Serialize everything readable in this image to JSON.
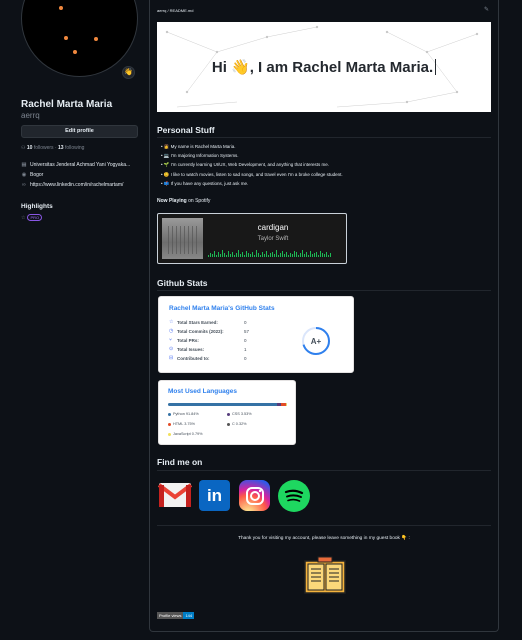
{
  "profile": {
    "full_name": "Rachel Marta Maria",
    "username": "aerrq",
    "status_emoji": "👋",
    "edit_label": "Edit profile",
    "followers_count": "10",
    "followers_label": "followers",
    "following_count": "13",
    "following_label": "following",
    "separator": "·",
    "organization": "Universitas Jenderal Achmad Yani Yogyaka...",
    "location": "Bogor",
    "link": "https://www.linkedin.com/in/rachelmartam/",
    "highlights_title": "Highlights",
    "pro_badge": "PRO"
  },
  "readme": {
    "path": "aerrq / README.md",
    "banner_text": "Hi 👋, I am Rachel Marta Maria.",
    "personal_heading": "Personal Stuff",
    "bullets": [
      "👩 My name is Rachel Marta Maria.",
      "💻 I'm majoring Information Systems.",
      "🌱 I'm currently learning UI/UX, Web Development, and anything that interests me.",
      "😊 I like to watch movies, listen to sad songs, and travel even I'm a broke college student.",
      "📫 If you have any questions, just ask me."
    ],
    "now_playing_bold": "Now Playing",
    "now_playing_rest": " on Spotify",
    "song": "cardigan",
    "artist": "Taylor Swift",
    "github_heading": "Github Stats",
    "find_heading": "Find me on",
    "thanks_text": "Thank you for visiting my account, please leave something in my guest book 👇 :",
    "views_label": "Profile views",
    "views_count": "144"
  },
  "github_stats": {
    "title": "Rachel Marta Maria's GitHub Stats",
    "rows": [
      {
        "label": "Total Stars Earned:",
        "value": "0"
      },
      {
        "label": "Total Commits (2022):",
        "value": "57"
      },
      {
        "label": "Total PRs:",
        "value": "0"
      },
      {
        "label": "Total Issues:",
        "value": "1"
      },
      {
        "label": "Contributed to:",
        "value": "0"
      }
    ],
    "rank": "A+",
    "rank_progress": 0.7
  },
  "languages": {
    "title": "Most Used Languages",
    "items": [
      {
        "name": "Python 91.84%",
        "percent": 91.84,
        "color": "#3572A5"
      },
      {
        "name": "CSS 3.53%",
        "percent": 3.53,
        "color": "#563d7c"
      },
      {
        "name": "HTML 3.75%",
        "percent": 3.75,
        "color": "#e34c26"
      },
      {
        "name": "C 0.32%",
        "percent": 0.32,
        "color": "#555555"
      },
      {
        "name": "JavaScript 0.79%",
        "percent": 0.79,
        "color": "#f1e05a"
      }
    ]
  },
  "colors": {
    "background": "#0d1117",
    "accent": "#2f80ed",
    "spotify_green": "#1db954",
    "linkedin_blue": "#0a66c2"
  }
}
